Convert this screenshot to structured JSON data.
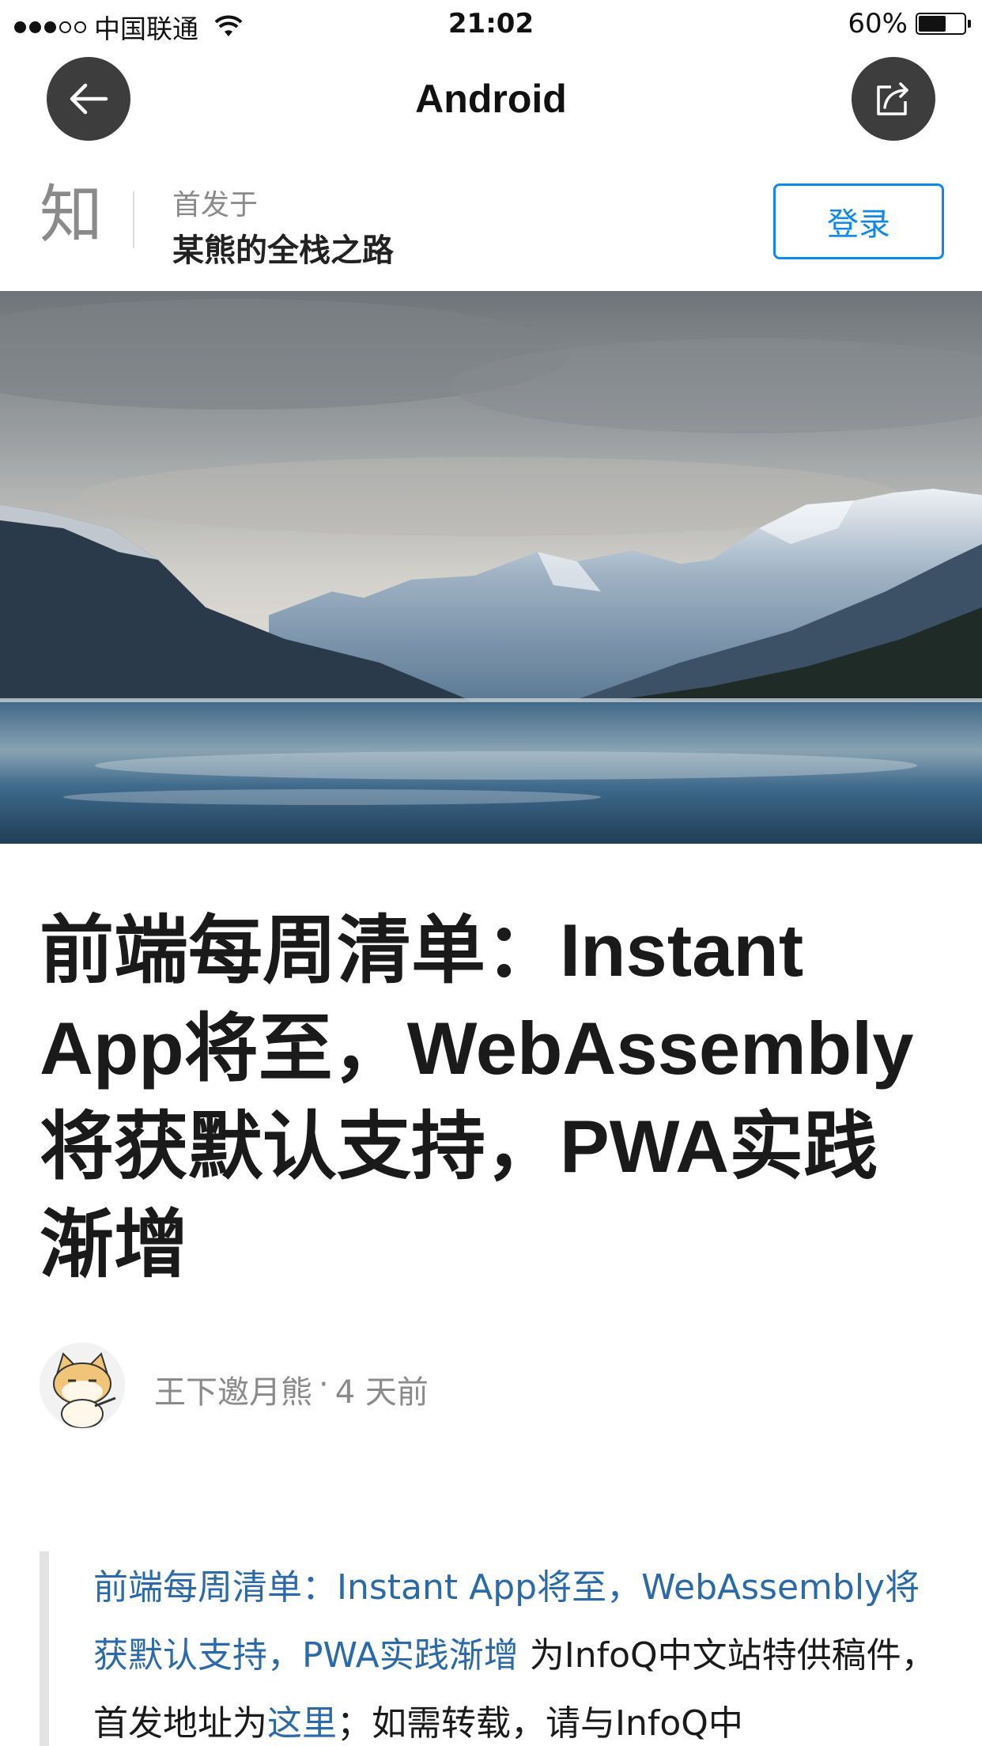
{
  "status_bar": {
    "carrier": "中国联通",
    "time": "21:02",
    "battery_percent": "60%",
    "battery_level": 0.6,
    "signal_bars": 3,
    "signal_total": 5
  },
  "nav": {
    "title": "Android",
    "back_icon": "arrow-left-icon",
    "share_icon": "share-icon"
  },
  "publication": {
    "logo_text": "知",
    "pre_label": "首发于",
    "name": "某熊的全栈之路",
    "login_label": "登录"
  },
  "article": {
    "title": "前端每周清单：Instant App将至，WebAssembly将获默认支持，PWA实践渐增",
    "author": "王下邀月熊",
    "separator": "·",
    "time_ago": "4 天前",
    "quote": {
      "link1": "前端每周清单：Instant App将至，WebAssembly将获默认支持，PWA实践渐增",
      "text1": " 为InfoQ中文站特供稿件，首发地址为",
      "link2": "这里",
      "text2": "；如需转载，请与InfoQ中"
    }
  },
  "colors": {
    "accent": "#0f88eb",
    "link": "#2b6aa8",
    "nav_button": "#3d3d3d"
  }
}
